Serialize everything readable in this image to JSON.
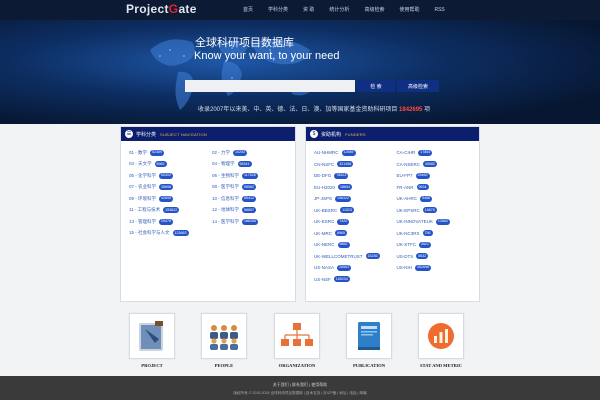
{
  "header": {
    "logo_left": "Project",
    "logo_mid": "G",
    "logo_right": "ate",
    "nav": [
      "首页",
      "学科分类",
      "资 助",
      "统计分析",
      "高级检索",
      "使用帮助",
      "RSS"
    ]
  },
  "hero": {
    "title": "全球科研项目数据库",
    "subtitle": "Know your want, to your need",
    "search_placeholder": "",
    "search_button": "检 索",
    "advanced_button": "高级检索",
    "stats_prefix": "收录2007年以来美、中、英、德、法、日、澳、加等国家基金资助科研项目",
    "stats_number": "1842695",
    "stats_suffix": " 项"
  },
  "subjects_panel": {
    "title_cn": "学科分类",
    "title_en": "SUBJECT NAVIGATION",
    "items": [
      {
        "label": "01 - 数学",
        "count": "52369"
      },
      {
        "label": "02 - 力学",
        "count": "10253"
      },
      {
        "label": "03 - 天文学",
        "count": "8962"
      },
      {
        "label": "04 - 物理学",
        "count": "96341"
      },
      {
        "label": "05 - 化学科学",
        "count": "65302"
      },
      {
        "label": "06 - 生物科学",
        "count": "117528"
      },
      {
        "label": "07 - 农业科学",
        "count": "35698"
      },
      {
        "label": "08 - 医学科学",
        "count": "98562"
      },
      {
        "label": "09 - 环境科学",
        "count": "42695"
      },
      {
        "label": "10 - 信息科学",
        "count": "85412"
      },
      {
        "label": "11 - 工程与技术",
        "count": "153622"
      },
      {
        "label": "12 - 地球科学",
        "count": "56897"
      },
      {
        "label": "13 - 管理科学",
        "count": "25478"
      },
      {
        "label": "14 - 医学科学",
        "count": "186356"
      },
      {
        "label": "15 - 社会科学与人文",
        "count": "123663"
      }
    ]
  },
  "funders_panel": {
    "title_cn": "资助机构",
    "title_en": "FUNDERS",
    "items": [
      {
        "label": "AU-NHMRC",
        "count": "12589"
      },
      {
        "label": "CA-CIHR",
        "count": "17854"
      },
      {
        "label": "CN-NSFC",
        "count": "321456"
      },
      {
        "label": "CA-NSERC",
        "count": "45982"
      },
      {
        "label": "DE-DFG",
        "count": "78523"
      },
      {
        "label": "EU-FP7",
        "count": "25469"
      },
      {
        "label": "EU-H2020",
        "count": "18654"
      },
      {
        "label": "FR-ANR",
        "count": "9634"
      },
      {
        "label": "JP-JSPS",
        "count": "156322"
      },
      {
        "label": "UK-AHRC",
        "count": "5486"
      },
      {
        "label": "UK-BBSRC",
        "count": "11523"
      },
      {
        "label": "UK-EPSRC",
        "count": "16875"
      },
      {
        "label": "UK-ESRC",
        "count": "7520"
      },
      {
        "label": "UK-INNOVATEUK",
        "count": "13562"
      },
      {
        "label": "UK-MRC",
        "count": "8965"
      },
      {
        "label": "UK-NC3RS",
        "count": "756"
      },
      {
        "label": "UK-NERC",
        "count": "9852"
      },
      {
        "label": "UK-STFC",
        "count": "4521"
      },
      {
        "label": "UK-WELLCOMETRUST",
        "count": "15236"
      },
      {
        "label": "US-DTS",
        "count": "5632"
      },
      {
        "label": "US-NASA",
        "count": "28563"
      },
      {
        "label": "US-NIH",
        "count": "452698"
      },
      {
        "label": "US-NSF",
        "count": "185234"
      }
    ]
  },
  "categories": [
    {
      "label": "PROJECT",
      "icon": "project-icon"
    },
    {
      "label": "PEOPLE",
      "icon": "people-icon"
    },
    {
      "label": "ORGANIZATION",
      "icon": "organization-icon"
    },
    {
      "label": "PUBLICATION",
      "icon": "publication-icon"
    },
    {
      "label": "STAT AND METRIC",
      "icon": "stat-icon"
    }
  ],
  "footer": {
    "links": "关于我们 | 联系我们 | 使用帮助",
    "copyright": "版权所有 © 2015-2018 全球科研项目数据库 | 技术支持 | 京ICP备 | 地址 | 电话 | 邮编"
  },
  "colors": {
    "navy": "#0b1f6e",
    "badge": "#2454c8",
    "link": "#2e5db6",
    "accent": "#f3b14a",
    "highlight": "#ff4a40"
  }
}
